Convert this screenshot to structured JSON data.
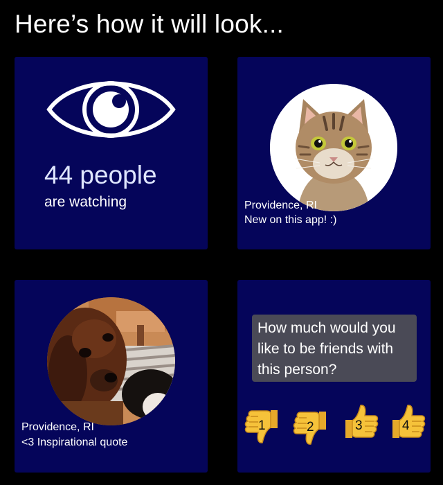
{
  "header": {
    "title": "Here’s how it will look..."
  },
  "watch_card": {
    "count": "44 people",
    "subtitle": "are watching",
    "icon": "eye-icon"
  },
  "profile_card_1": {
    "image": "cat-photo",
    "location": "Providence, RI",
    "bio": "New on this app! :)"
  },
  "profile_card_2": {
    "image": "dog-photo",
    "location": "Providence, RI",
    "bio": "<3 Inspirational quote"
  },
  "rating_card": {
    "question": "How much would you like to be friends with this person?",
    "options": [
      {
        "label": "1",
        "direction": "down"
      },
      {
        "label": "2",
        "direction": "down"
      },
      {
        "label": "3",
        "direction": "up"
      },
      {
        "label": "4",
        "direction": "up"
      }
    ]
  },
  "colors": {
    "background": "#000000",
    "card": "#05055a",
    "question_bubble": "#4a4a56",
    "thumb": "#f6c23a"
  }
}
